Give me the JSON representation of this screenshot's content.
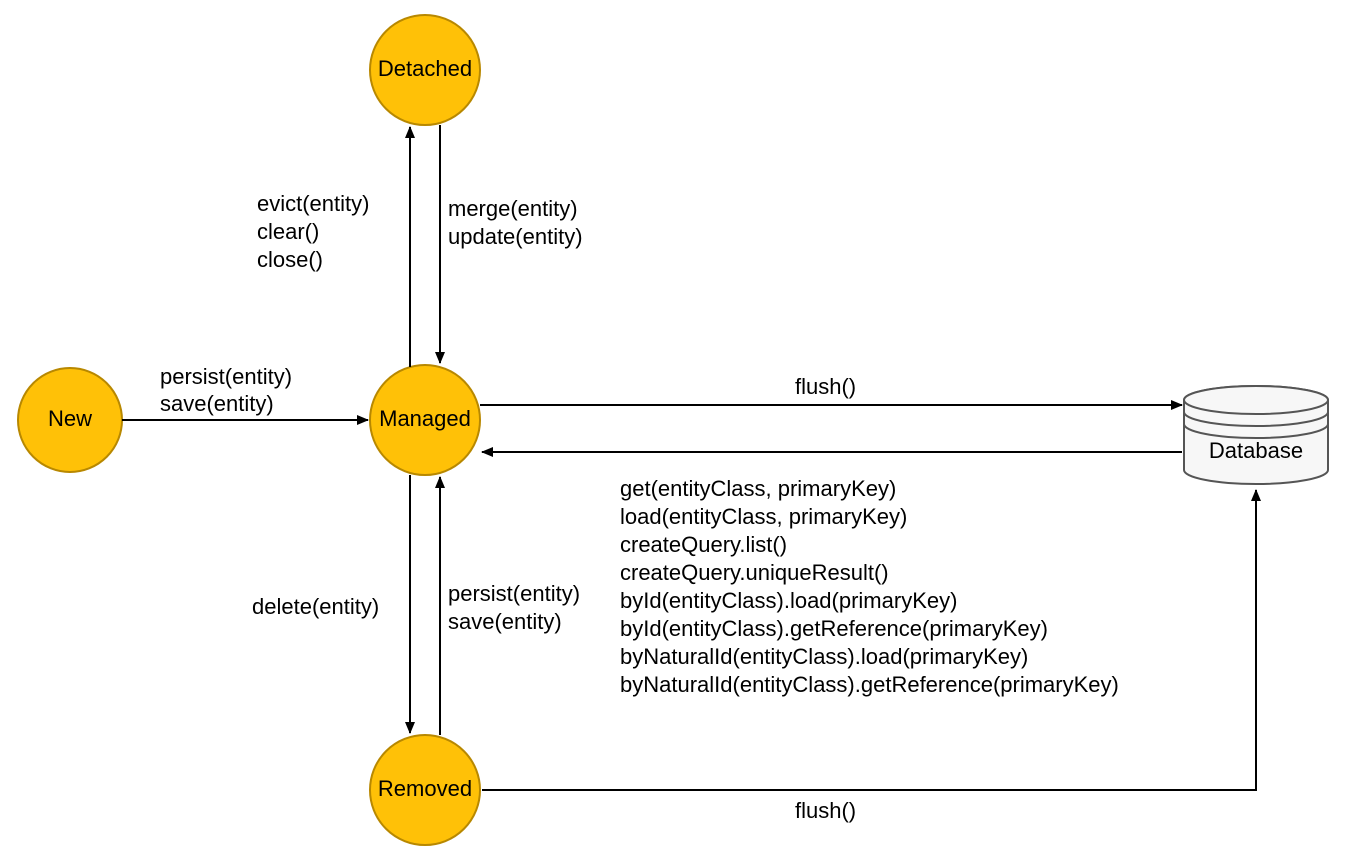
{
  "nodes": {
    "new": "New",
    "detached": "Detached",
    "managed": "Managed",
    "removed": "Removed",
    "database": "Database"
  },
  "edges": {
    "new_to_managed": [
      "persist(entity)",
      "save(entity)"
    ],
    "managed_to_detached": [
      "evict(entity)",
      "clear()",
      "close()"
    ],
    "detached_to_managed": [
      "merge(entity)",
      "update(entity)"
    ],
    "managed_to_removed": [
      "delete(entity)"
    ],
    "removed_to_managed": [
      "persist(entity)",
      "save(entity)"
    ],
    "managed_to_db": [
      "flush()"
    ],
    "db_to_managed": [
      "get(entityClass, primaryKey)",
      "load(entityClass, primaryKey)",
      "createQuery.list()",
      "createQuery.uniqueResult()",
      "byId(entityClass).load(primaryKey)",
      "byId(entityClass).getReference(primaryKey)",
      "byNaturalId(entityClass).load(primaryKey)",
      "byNaturalId(entityClass).getReference(primaryKey)"
    ],
    "removed_to_db": [
      "flush()"
    ]
  }
}
